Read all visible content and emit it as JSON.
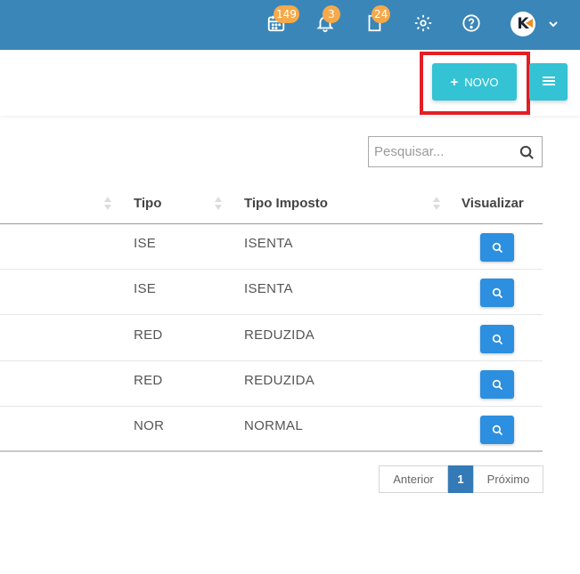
{
  "topbar": {
    "calendar_badge": "149",
    "bell_badge": "3",
    "doc_badge": "24",
    "avatar_letter": "K",
    "color": "#3a86b8"
  },
  "toolbar": {
    "novo_plus": "+",
    "novo_label": "NOVO",
    "accent": "#33c3d5"
  },
  "search": {
    "placeholder": "Pesquisar..."
  },
  "table": {
    "headers": {
      "tipo": "Tipo",
      "tipo_imposto": "Tipo Imposto",
      "visualizar": "Visualizar"
    },
    "rows": [
      {
        "tipo": "ISE",
        "tipo_imposto": "ISENTA"
      },
      {
        "tipo": "ISE",
        "tipo_imposto": "ISENTA"
      },
      {
        "tipo": "RED",
        "tipo_imposto": "REDUZIDA"
      },
      {
        "tipo": "RED",
        "tipo_imposto": "REDUZIDA"
      },
      {
        "tipo": "NOR",
        "tipo_imposto": "NORMAL"
      }
    ],
    "view_button_color": "#2c8fe0"
  },
  "pagination": {
    "prev": "Anterior",
    "current": "1",
    "next": "Próximo"
  }
}
